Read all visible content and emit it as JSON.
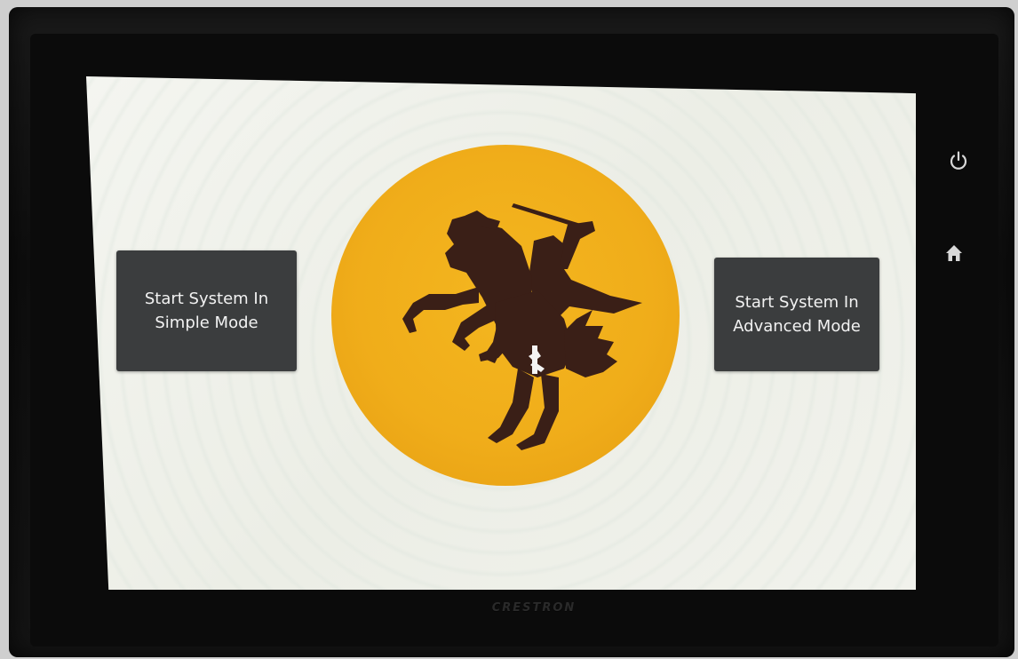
{
  "screen": {
    "simple_button": {
      "label": "Start System In\nSimple Mode"
    },
    "advanced_button": {
      "label": "Start System In\nAdvanced Mode"
    },
    "logo": {
      "name": "knight-on-horse-logo",
      "circle_color": "#f1b21f",
      "silhouette_color": "#3a1f17"
    }
  },
  "side_controls": {
    "power": {
      "icon": "power-icon"
    },
    "home": {
      "icon": "home-icon"
    }
  },
  "device": {
    "brand": "CRESTRON"
  }
}
